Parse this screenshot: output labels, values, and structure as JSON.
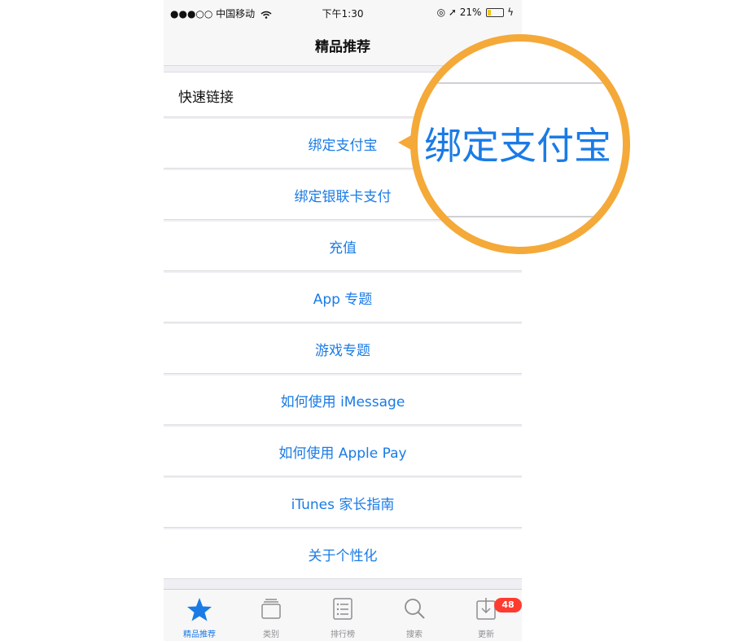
{
  "status_bar": {
    "carrier": "●●●○○ 中国移动",
    "time": "下午1:30",
    "battery": "21%",
    "battery_level": 0.21
  },
  "nav": {
    "title": "精品推荐"
  },
  "section_header": "快速链接",
  "links": [
    {
      "label": "绑定支付宝"
    },
    {
      "label": "绑定银联卡支付"
    },
    {
      "label": "充值"
    },
    {
      "label": "App 专题"
    },
    {
      "label": "游戏专题"
    },
    {
      "label": "如何使用 iMessage"
    },
    {
      "label": "如何使用 Apple Pay"
    },
    {
      "label": "iTunes 家长指南"
    },
    {
      "label": "关于个性化"
    }
  ],
  "magnifier": {
    "text": "绑定支付宝"
  },
  "tabs": [
    {
      "label": "精品推荐",
      "icon": "star-icon",
      "active": true
    },
    {
      "label": "类别",
      "icon": "categories-icon"
    },
    {
      "label": "排行榜",
      "icon": "list-icon"
    },
    {
      "label": "搜索",
      "icon": "search-icon"
    },
    {
      "label": "更新",
      "icon": "download-icon",
      "badge": "48"
    }
  ],
  "colors": {
    "accent": "#1a7be6",
    "highlight_ring": "#f4a938",
    "badge": "#ff3b30"
  }
}
